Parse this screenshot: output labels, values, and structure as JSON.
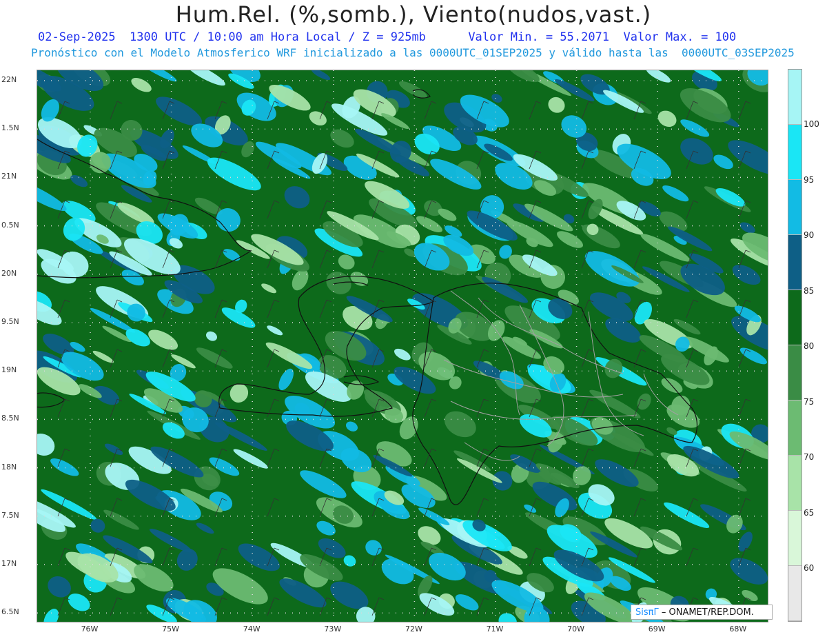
{
  "title": "Hum.Rel. (%,somb.), Viento(nudos,vast.)",
  "subtitle_line1": "02-Sep-2025  1300 UTC / 10:00 am Hora Local / Z = 925mb      Valor Min. = 55.2071  Valor Max. = 100",
  "subtitle_line2": "Pronóstico con el Modelo Atmosferico WRF inicializado a las 0000UTC_01SEP2025 y válido hasta las  0000UTC_03SEP2025",
  "y_axis_labels": [
    "22N",
    "1.5N",
    "21N",
    "0.5N",
    "20N",
    "9.5N",
    "19N",
    "8.5N",
    "18N",
    "7.5N",
    "17N",
    "6.5N"
  ],
  "x_axis_labels": [
    "76W",
    "75W",
    "74W",
    "73W",
    "72W",
    "71W",
    "70W",
    "69W",
    "68W"
  ],
  "colorbar": {
    "levels": [
      "100",
      "95",
      "90",
      "85",
      "80",
      "75",
      "70",
      "65",
      "60"
    ],
    "colors": [
      "#a6f5f5",
      "#1ae6f5",
      "#12bbe4",
      "#0e5f86",
      "#0d6a1b",
      "#3a8c45",
      "#6cbb72",
      "#a8e3a8",
      "#d9f7d9",
      "#e8e8e8"
    ]
  },
  "credit": {
    "logo": "SisπΓ",
    "text": "– ONAMET/REP.DOM."
  },
  "map_colors": {
    "deep_green": "#0d6a1b",
    "mid_green": "#3a8c45",
    "light_green": "#6cbb72",
    "pale_green": "#a8e3a8",
    "navy_blue": "#0e5f86",
    "sky_blue": "#12bbe4",
    "cyan": "#1ae6f5",
    "pale_cyan": "#a6f5f5",
    "coastline": "#111111",
    "provinces": "#a0a0a0",
    "grid": "#d8d8d8"
  }
}
